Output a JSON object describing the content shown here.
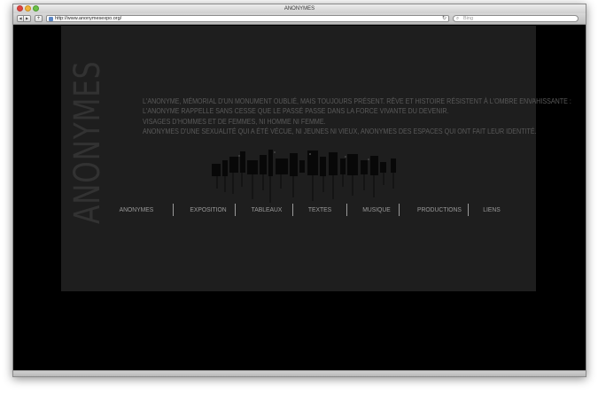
{
  "window": {
    "title": "ANONYMES",
    "url": "http://www.anonymesexpo.org/",
    "search_placeholder": "Bing"
  },
  "toolbar": {
    "back": "◀",
    "forward": "▶",
    "add": "+",
    "reload": "↻",
    "search_icon": "⌕"
  },
  "page": {
    "vertical_title": "ANONYMES",
    "intro_lines": [
      "L'ANONYME, MÉMORIAL D'UN MONUMENT OUBLIÉ, MAIS TOUJOURS PRÉSENT. RÊVE ET HISTOIRE RÉSISTENT À L'OMBRE ENVAHISSANTE :",
      "L'ANONYME RAPPELLE SANS CESSE QUE LE PASSÉ PASSE DANS LA FORCE VIVANTE DU DEVENIR.",
      "VISAGES D'HOMMES ET DE FEMMES, NI HOMME NI FEMME.",
      "ANONYMES D'UNE SEXUALITÉ QUI A ÉTÉ VÉCUE, NI JEUNES NI VIEUX, ANONYMES DES ESPACES QUI ONT FAIT LEUR IDENTITÉ."
    ],
    "nav": [
      "ANONYMES",
      "EXPOSITION",
      "TABLEAUX",
      "TEXTES",
      "MUSIQUE",
      "PRODUCTIONS",
      "LIENS"
    ]
  },
  "colors": {
    "page_background": "#000000",
    "panel_background": "#1e1e1e",
    "title_text": "#323232",
    "body_text": "#5a5a5a",
    "nav_text": "#9a9a9a"
  }
}
